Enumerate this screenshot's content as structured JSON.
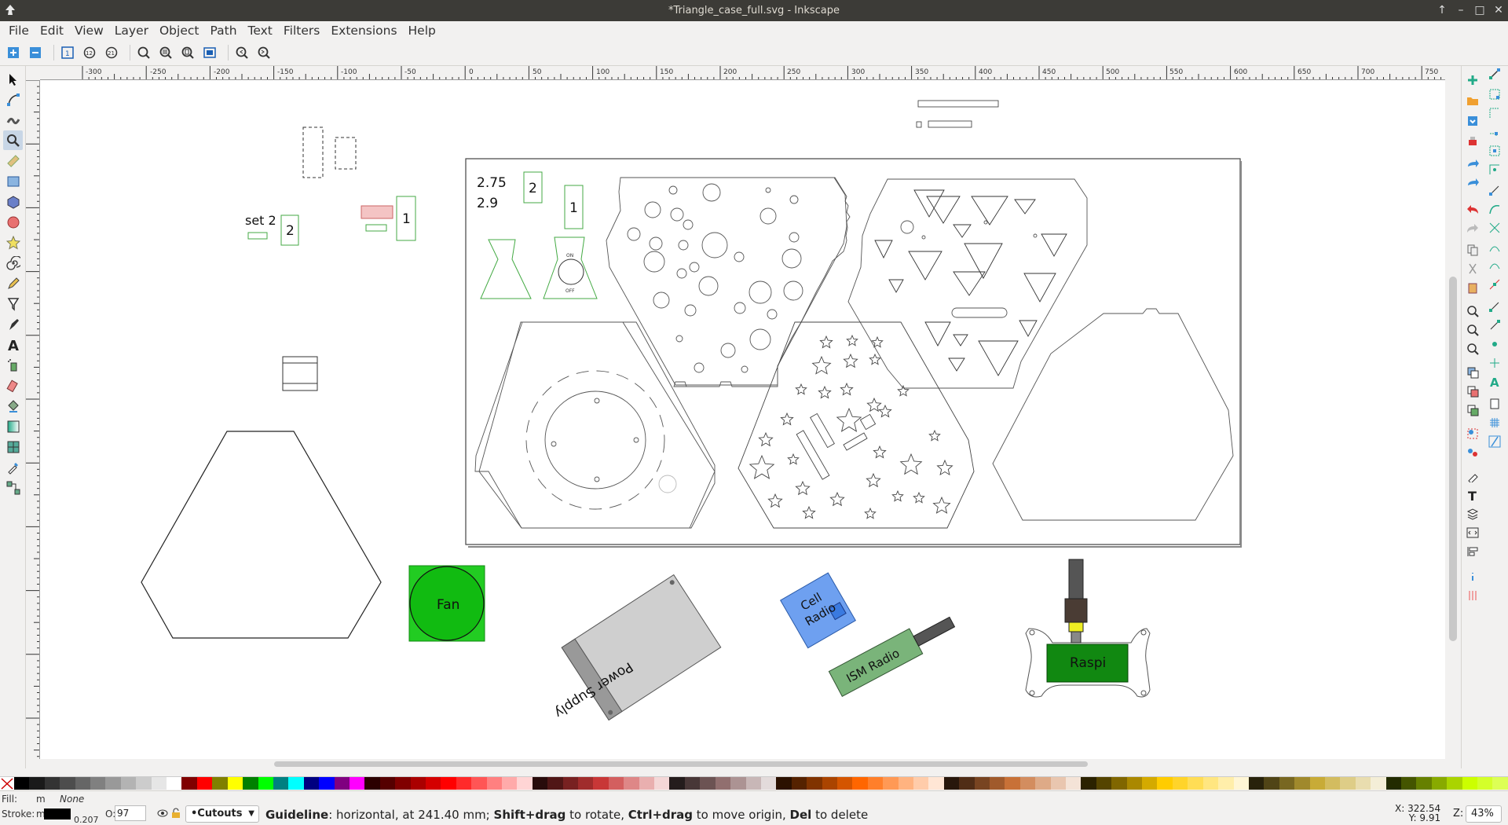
{
  "window": {
    "title": "*Triangle_case_full.svg - Inkscape",
    "controls": [
      "↑",
      "–",
      "□",
      "✕"
    ]
  },
  "menu": [
    "File",
    "Edit",
    "View",
    "Layer",
    "Object",
    "Path",
    "Text",
    "Filters",
    "Extensions",
    "Help"
  ],
  "toolbar_icons": [
    "snap-select-icon",
    "snap-deselect-icon",
    "zoom-1-1-icon",
    "zoom-1-2-icon",
    "zoom-2-1-icon",
    "zoom-selection-icon",
    "zoom-drawing-icon",
    "zoom-page-icon",
    "zoom-page-width-icon",
    "zoom-prev-icon",
    "zoom-next-icon"
  ],
  "tools": [
    "selector-tool",
    "node-tool",
    "tweak-tool",
    "zoom-tool",
    "measure-tool",
    "rectangle-tool",
    "3dbox-tool",
    "ellipse-tool",
    "star-tool",
    "spiral-tool",
    "pencil-tool",
    "pen-tool",
    "calligraphy-tool",
    "text-tool",
    "spray-tool",
    "eraser-tool",
    "paint-bucket-tool",
    "gradient-tool",
    "mesh-tool",
    "dropper-tool",
    "connector-tool"
  ],
  "ruler": {
    "h_labels": [
      "-300",
      "-250",
      "-200",
      "-150",
      "-100",
      "-50",
      "0",
      "50",
      "100",
      "150",
      "200",
      "250",
      "300",
      "350",
      "400",
      "450",
      "500",
      "550",
      "600",
      "650",
      "700",
      "750"
    ]
  },
  "canvas_labels": {
    "set2": "set 2",
    "set2_num": "2",
    "part1_num": "1",
    "ratio_a": "2.75",
    "ratio_b": "2.9",
    "sheet_num2": "2",
    "sheet_num1": "1",
    "on": "ON",
    "off": "OFF",
    "fan": "Fan",
    "power_supply": "Power Supply",
    "cell_radio": "Cell Radio",
    "cell_radio_l1": "Cell",
    "cell_radio_l2": "Radio",
    "ism_radio": "ISM Radio",
    "raspi": "Raspi"
  },
  "status": {
    "fill_label": "Fill:",
    "fill_value": "m",
    "fill_none": "None",
    "stroke_label": "Stroke:",
    "stroke_value": "m",
    "stroke_width": "0.207",
    "opacity_label": "O:",
    "opacity_value": "97",
    "layer": "•Cutouts",
    "msg_b1": "Guideline",
    "msg_t1": ": horizontal, at 241.40 mm; ",
    "msg_b2": "Shift+drag",
    "msg_t2": " to rotate, ",
    "msg_b3": "Ctrl+drag",
    "msg_t3": " to move origin, ",
    "msg_b4": "Del",
    "msg_t4": " to delete",
    "x_label": "X:",
    "x_value": "322.54",
    "y_label": "Y:",
    "y_value": "9.91",
    "zoom_label": "Z:",
    "zoom_value": "43%"
  },
  "palette": [
    "#000000",
    "#1a1a1a",
    "#333333",
    "#4d4d4d",
    "#666666",
    "#808080",
    "#999999",
    "#b3b3b3",
    "#cccccc",
    "#e6e6e6",
    "#ffffff",
    "#800000",
    "#ff0000",
    "#808000",
    "#ffff00",
    "#008000",
    "#00ff00",
    "#008080",
    "#00ffff",
    "#000080",
    "#0000ff",
    "#800080",
    "#ff00ff",
    "#2b0000",
    "#550000",
    "#800000",
    "#aa0000",
    "#d40000",
    "#ff0000",
    "#ff2a2a",
    "#ff5555",
    "#ff8080",
    "#ffaaaa",
    "#ffd5d5",
    "#280b0b",
    "#501616",
    "#782121",
    "#a02c2c",
    "#c83737",
    "#d35f5f",
    "#de8787",
    "#e9afaf",
    "#f4d7d7",
    "#241c1c",
    "#483737",
    "#6c5353",
    "#916f6f",
    "#ac9393",
    "#c8b7b7",
    "#e3dbdb",
    "#2b1100",
    "#552200",
    "#803300",
    "#aa4400",
    "#d45500",
    "#ff6600",
    "#ff7f2a",
    "#ff9955",
    "#ffb380",
    "#ffccaa",
    "#ffe6d5",
    "#28170b",
    "#502d16",
    "#784421",
    "#a05a2c",
    "#c87137",
    "#d38d5f",
    "#deaa87",
    "#e9c6af",
    "#f4e3d7",
    "#2b2200",
    "#554400",
    "#806600",
    "#aa8800",
    "#d4aa00",
    "#ffcc00",
    "#ffd42a",
    "#ffdd55",
    "#ffe680",
    "#ffeeaa",
    "#fff6d5",
    "#28220b",
    "#504416",
    "#786721",
    "#a0892c",
    "#c8ab37",
    "#d3bc5f",
    "#decd87",
    "#e9ddaf",
    "#f4eed7",
    "#222b00",
    "#445500",
    "#668000",
    "#88aa00",
    "#aad400",
    "#ccff00",
    "#d4ff2a",
    "#ddff55"
  ]
}
